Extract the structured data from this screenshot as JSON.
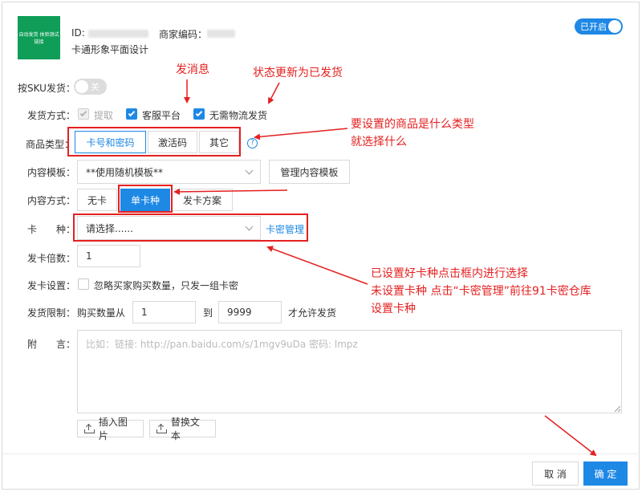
{
  "header": {
    "logo_text": "自动发货 体验测试链接",
    "id_label": "ID:",
    "merchant_code_label": "商家编码：",
    "product_name": "卡通形象平面设计",
    "status_toggle": "已开启"
  },
  "form": {
    "sku_label": "按SKU发货：",
    "sku_toggle": "关",
    "delivery_label": "发货方式：",
    "delivery_options": [
      "提取",
      "客服平台",
      "无需物流发货"
    ],
    "goods_type_label": "商品类型：",
    "goods_types": [
      "卡号和密码",
      "激活码",
      "其它"
    ],
    "help_glyph": "?",
    "template_label": "内容模板：",
    "template_value": "**使用随机模板**",
    "manage_template": "管理内容模板",
    "content_mode_label": "内容方式：",
    "content_modes": [
      "无卡",
      "单卡种",
      "发卡方案"
    ],
    "card_type_label": "卡　　种：",
    "card_type_placeholder": "请选择......",
    "card_manage_link": "卡密管理",
    "multiplier_label": "发卡倍数：",
    "multiplier_value": "1",
    "card_setting_label": "发卡设置：",
    "card_setting_option": "忽略买家购买数量，只发一组卡密",
    "limit_label": "发货限制：",
    "limit_prefix": "购买数量从",
    "limit_min": "1",
    "limit_to": "到",
    "limit_max": "9999",
    "limit_suffix": "才允许发货",
    "note_label": "附　　言：",
    "note_placeholder": "比如：链接: http://pan.baidu.com/s/1mgv9uDa 密码: lmpz",
    "insert_image": "插入图片",
    "replace_text": "替换文本"
  },
  "footer": {
    "cancel": "取 消",
    "confirm": "确 定"
  },
  "annotations": {
    "send_message": "发消息",
    "status_update": "状态更新为已发货",
    "goods_type_line1": "要设置的商品是什么类型",
    "goods_type_line2": "就选择什么",
    "card_line1": "已设置好卡种点击框内进行选择",
    "card_line2": "未设置卡种 点击“卡密管理”前往91卡密仓库",
    "card_line3": "设置卡种"
  },
  "colors": {
    "accent": "#1e88e5",
    "annotation": "#e52020",
    "logo_bg": "#0f9d58"
  }
}
